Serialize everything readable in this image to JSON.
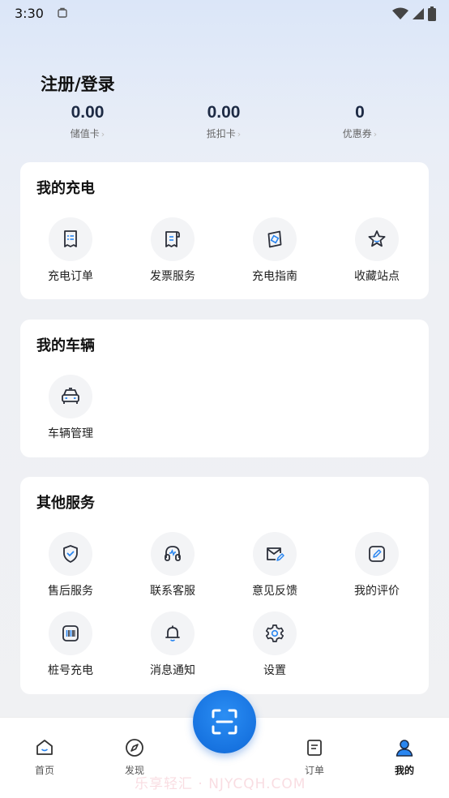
{
  "status_bar": {
    "time": "3:30"
  },
  "header": {
    "login_label": "注册/登录"
  },
  "stats": [
    {
      "value": "0.00",
      "label": "储值卡"
    },
    {
      "value": "0.00",
      "label": "抵扣卡"
    },
    {
      "value": "0",
      "label": "优惠券"
    }
  ],
  "my_charging": {
    "title": "我的充电",
    "items": [
      {
        "label": "充电订单",
        "icon": "receipt-icon"
      },
      {
        "label": "发票服务",
        "icon": "invoice-icon"
      },
      {
        "label": "充电指南",
        "icon": "compass-icon"
      },
      {
        "label": "收藏站点",
        "icon": "star-icon"
      }
    ]
  },
  "my_vehicle": {
    "title": "我的车辆",
    "items": [
      {
        "label": "车辆管理",
        "icon": "car-icon"
      }
    ]
  },
  "other_services": {
    "title": "其他服务",
    "items": [
      {
        "label": "售后服务",
        "icon": "shield-check-icon"
      },
      {
        "label": "联系客服",
        "icon": "headset-icon"
      },
      {
        "label": "意见反馈",
        "icon": "mail-edit-icon"
      },
      {
        "label": "我的评价",
        "icon": "edit-icon"
      },
      {
        "label": "桩号充电",
        "icon": "barcode-icon"
      },
      {
        "label": "消息通知",
        "icon": "bell-icon"
      },
      {
        "label": "设置",
        "icon": "gear-icon"
      }
    ]
  },
  "bottom_nav": {
    "items": [
      {
        "label": "首页",
        "icon": "home-icon"
      },
      {
        "label": "发现",
        "icon": "discover-icon"
      },
      {
        "label": "订单",
        "icon": "order-icon"
      },
      {
        "label": "我的",
        "icon": "profile-icon"
      }
    ],
    "active": "我的",
    "scan_icon": "scan-icon"
  },
  "watermark": "乐享轻汇 · NJYCQH.COM",
  "colors": {
    "accent": "#1773e0",
    "icon_blue": "#2a86f0",
    "icon_dark": "#2b2f3a"
  }
}
